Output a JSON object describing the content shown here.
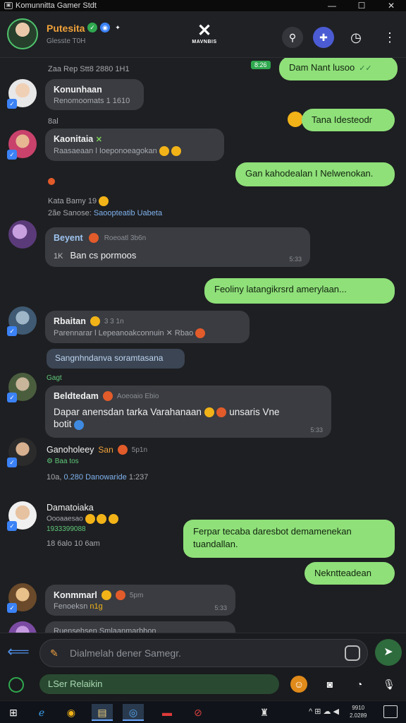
{
  "window": {
    "title": "Komunnitta Gamer Stdt",
    "controls": [
      "—",
      "☐",
      "✕"
    ]
  },
  "header": {
    "name": "Putesita",
    "subtitle": "Glesste T0H",
    "logo_text": "MAVNBIS"
  },
  "messages": {
    "m0_meta": "Zaa Rep Stt8  2880 1H1",
    "m0_out": "Dam Nant lusoo",
    "m0_tag": "8:26",
    "m1_name": "Konunhaan",
    "m1_sub": "Renomoomats 1 1610",
    "m1_meta": "8al",
    "m2_out": "Tana Idesteodr",
    "m3_name": "Kaonitaia",
    "m3_sub": "Raasaeaan l Ioeponoeagokan",
    "m4_out": "Gan kahodealan I Nelwenokan.",
    "m5_meta1": "Kata  Bamy 19",
    "m5_meta2_a": "2ãe  Sanose:",
    "m5_meta2_b": "Saoopteatib Uabeta",
    "m6_name": "Beyent",
    "m6_timehdr": "Roeoatl 3b6n",
    "m6_lead": "1K",
    "m6_text": "Ban cs pormoos",
    "m6_time": "5:33",
    "m7_out": "Feoliny latangikrsrd amerylaan...",
    "m8_name": "Rbaitan",
    "m8_timehdr": "3 3 1n",
    "m8_sub": "Parennarar l Lepeanoakconnuin",
    "m8_sub2": "Rbao",
    "m9_blue": "Sangnhndanva soramtasana",
    "m9_meta": "Gagt",
    "m10_name": "Beldtedam",
    "m10_timehdr": "Aoeoaio Ebio",
    "m10_line1": "Dapar anensdan tarka Varahanaan",
    "m10_line1b": "unsaris Vne",
    "m10_line2": "botit",
    "m10_time": "5:33",
    "m11_name": "Ganoholeey",
    "m11_timehdr": "San",
    "m11_time2": "5p1n",
    "m11_sub": "Baa tos",
    "m11_meta_a": "10a,",
    "m11_meta_b": "0.280 Danowaride",
    "m11_meta_c": "1:237",
    "m12_name": "Damatoiaka",
    "m12_sub": "Oooaaesao",
    "m12_sub2": "1933399088",
    "m12_meta": "18 6alo 10 6am",
    "m13_out": "Ferpar tecaba daresbot demamenekan tuandallan.",
    "m14_out": "Nekntteadean",
    "m15_name": "Konmmarl",
    "m15_time2": "5pm",
    "m15_sub": "Fenoeksn",
    "m15_sub2": "n1g",
    "m15_time": "5:33",
    "m16_partial": "Ruensehsen  Smlaanmarbhon"
  },
  "composer": {
    "placeholder": "Dialmelah dener Samegr.",
    "reply_label": "LSer Relaikin"
  },
  "taskbar": {
    "tray": "^  ⊞  ☁  ◀",
    "clock_line1": "9910",
    "clock_line2": "2.0289"
  },
  "colors": {
    "accent_green": "#8fe079",
    "badge_blue": "#3b82f6",
    "name_orange": "#f1a23a"
  }
}
